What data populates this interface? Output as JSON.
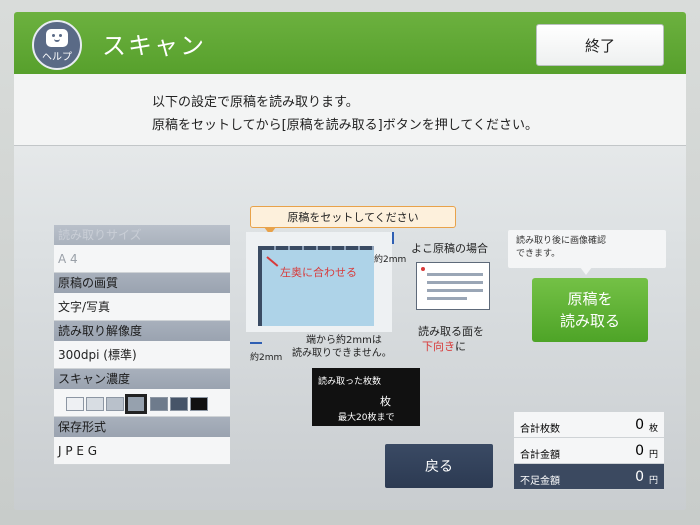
{
  "header": {
    "title": "スキャン",
    "help_label": "ヘルプ",
    "end_label": "終了"
  },
  "instruction": {
    "line1": "以下の設定で原稿を読み取ります。",
    "line2": "原稿をセットしてから[原稿を読み取る]ボタンを押してください。"
  },
  "settings": {
    "size": {
      "label": "読み取りサイズ",
      "value": "A 4"
    },
    "quality": {
      "label": "原稿の画質",
      "value": "文字/写真"
    },
    "resolution": {
      "label": "読み取り解像度",
      "value": "300dpi (標準)"
    },
    "density": {
      "label": "スキャン濃度",
      "levels": 7,
      "selected": 4
    },
    "format": {
      "label": "保存形式",
      "value": "J P E G"
    }
  },
  "diagram": {
    "callout": "原稿をセットしてください",
    "corner": "左奥に合わせる",
    "dim_right": "約2mm",
    "dim_bottom": "約2mm",
    "margin_note_1": "端から約2mmは",
    "margin_note_2": "読み取りできません。",
    "landscape_title": "よこ原稿の場合",
    "face_note_1": "読み取る面を",
    "face_note_2_red": "下向き",
    "face_note_2_tail": "に"
  },
  "counter": {
    "label": "読み取った枚数",
    "unit": "枚",
    "max": "最大20枚まで"
  },
  "buttons": {
    "back": "戻る",
    "scan_line1": "原稿を",
    "scan_line2": "読み取る"
  },
  "hint": {
    "line1": "読み取り後に画像確認",
    "line2": "できます。"
  },
  "totals": [
    {
      "label": "合計枚数",
      "value": "0",
      "unit": "枚"
    },
    {
      "label": "合計金額",
      "value": "0",
      "unit": "円"
    },
    {
      "label": "不足金額",
      "value": "0",
      "unit": "円"
    }
  ],
  "colors": {
    "header_green": "#5ea832",
    "scan_green": "#58ad2f",
    "dark_navy": "#2f3d55",
    "red": "#d83a3a"
  }
}
